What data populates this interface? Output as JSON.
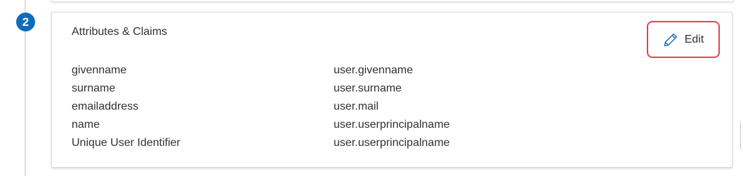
{
  "step": {
    "number": "2"
  },
  "card": {
    "title": "Attributes & Claims",
    "edit_label": "Edit",
    "edit_icon": "pencil-icon",
    "highlight_color": "#e8414e"
  },
  "claims": [
    {
      "name": "givenname",
      "value": "user.givenname"
    },
    {
      "name": "surname",
      "value": "user.surname"
    },
    {
      "name": "emailaddress",
      "value": "user.mail"
    },
    {
      "name": "name",
      "value": "user.userprincipalname"
    },
    {
      "name": "Unique User Identifier",
      "value": "user.userprincipalname"
    }
  ],
  "colors": {
    "accent": "#0f6cbd",
    "text": "#323130"
  }
}
